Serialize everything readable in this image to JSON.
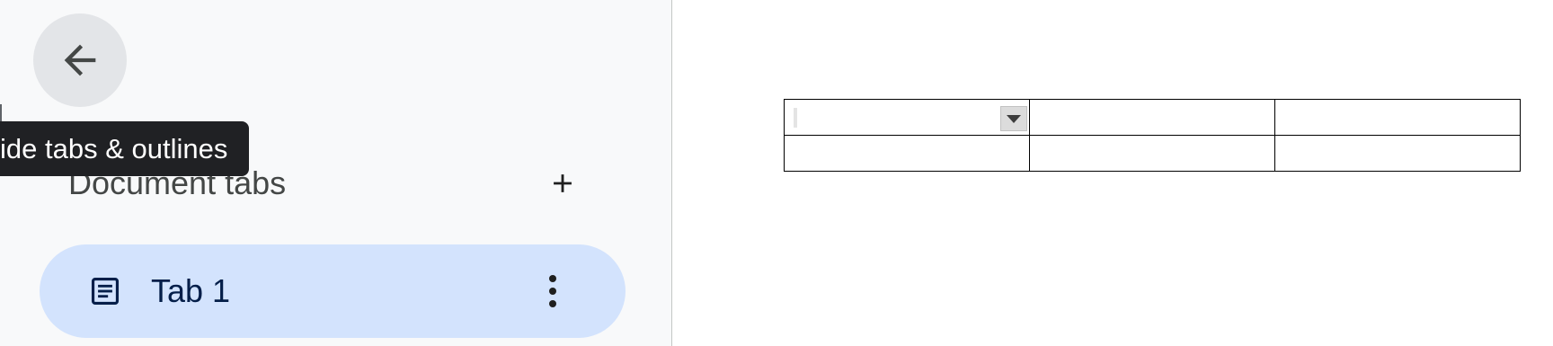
{
  "sidebar": {
    "back_button_tooltip": "ide tabs & outlines",
    "section_title": "Document tabs",
    "tabs": [
      {
        "label": "Tab 1",
        "icon": "document-icon",
        "selected": true
      }
    ]
  },
  "colors": {
    "sidebar_bg": "#f8f9fa",
    "selected_tab_bg": "#d3e3fd",
    "selected_tab_text": "#041e49",
    "tooltip_bg": "#202124",
    "back_button_bg": "#e3e5e8"
  },
  "document": {
    "table": {
      "rows": [
        [
          "",
          "",
          ""
        ],
        [
          "",
          "",
          ""
        ]
      ]
    }
  }
}
